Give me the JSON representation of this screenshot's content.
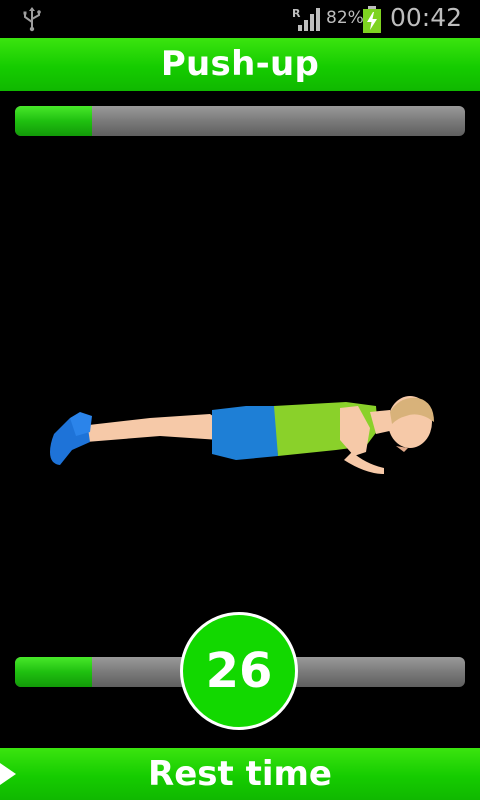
{
  "status_bar": {
    "icons": [
      "usb-icon",
      "roaming-signal-icon",
      "battery-charging-icon"
    ],
    "roaming_indicator": "R",
    "battery_percent": "82%",
    "time": "00:42"
  },
  "header": {
    "title": "Push-up"
  },
  "progress_top": {
    "value_fraction": 0.17
  },
  "exercise": {
    "illustration": "push-up-figure"
  },
  "countdown": {
    "value": "26"
  },
  "progress_bottom": {
    "value_fraction": 0.17
  },
  "footer": {
    "label": "Rest time",
    "icon": "play-icon"
  },
  "colors": {
    "accent_green": "#15cc00",
    "track_gray": "#7a7a7a",
    "background": "#000000"
  }
}
